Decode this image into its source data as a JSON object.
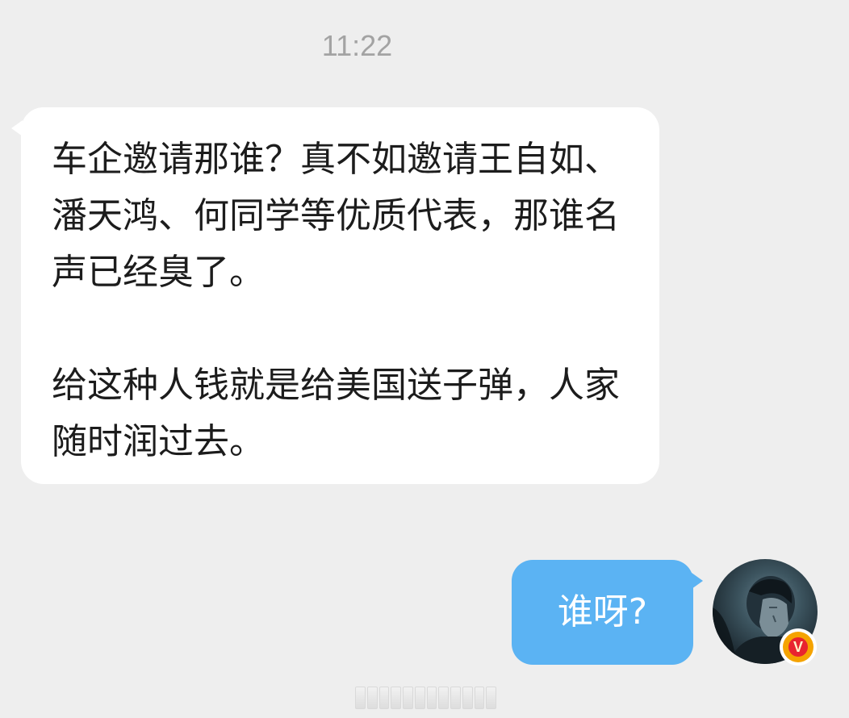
{
  "chat": {
    "timestamp": "11:22",
    "incoming_message": {
      "text": "车企邀请那谁？真不如邀请王自如、潘天鸿、何同学等优质代表，那谁名声已经臭了。\n\n给这种人钱就是给美国送子弹，人家随时润过去。",
      "bubble_color": "#ffffff"
    },
    "outgoing_message": {
      "text": "谁呀?",
      "bubble_color": "#5bb3f3"
    },
    "sender_avatar": {
      "icon": "user-avatar-photo",
      "verified_badge": "V",
      "badge_color": "#f5a300"
    }
  },
  "colors": {
    "background": "#eeeeee",
    "timestamp_text": "#a3a3a3",
    "incoming_text": "#1c1c1c",
    "outgoing_text": "#ffffff"
  }
}
